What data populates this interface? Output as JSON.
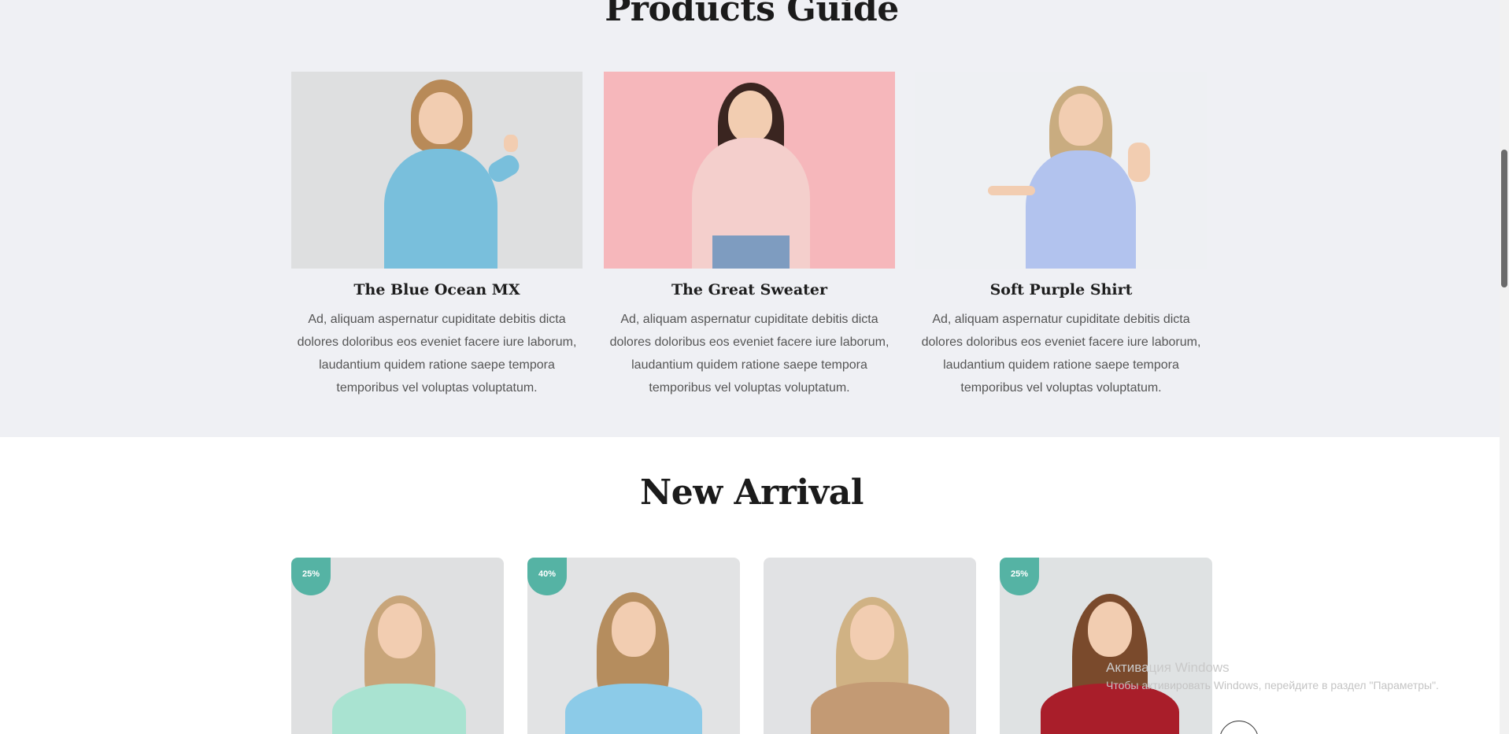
{
  "products_guide": {
    "title": "Products Guide",
    "items": [
      {
        "name": "The Blue Ocean MX",
        "description": "Ad, aliquam aspernatur cupiditate debitis dicta dolores doloribus eos eveniet facere iure laborum, laudantium quidem ratione saepe tempora temporibus vel voluptas voluptatum.",
        "bg": "#dedfe0",
        "garment": "#79bfdc"
      },
      {
        "name": "The Great Sweater",
        "description": "Ad, aliquam aspernatur cupiditate debitis dicta dolores doloribus eos eveniet facere iure laborum, laudantium quidem ratione saepe tempora temporibus vel voluptas voluptatum.",
        "bg": "#f6b7bb",
        "garment": "#f4cfcc"
      },
      {
        "name": "Soft Purple Shirt",
        "description": "Ad, aliquam aspernatur cupiditate debitis dicta dolores doloribus eos eveniet facere iure laborum, laudantium quidem ratione saepe tempora temporibus vel voluptas voluptatum.",
        "bg": "#eef0f3",
        "garment": "#b2c3ee"
      }
    ]
  },
  "new_arrival": {
    "title": "New Arrival",
    "items": [
      {
        "discount": "25%",
        "bg": "#dfe0e1",
        "garment": "#a9e3d1"
      },
      {
        "discount": "40%",
        "bg": "#e2e3e4",
        "garment": "#8ccbe8"
      },
      {
        "discount": "",
        "bg": "#e1e2e4",
        "garment": "#c39a74"
      },
      {
        "discount": "25%",
        "bg": "#dfe2e3",
        "garment": "#a91e2a"
      }
    ]
  },
  "os_overlay": {
    "activation_title": "Активация Windows",
    "activation_text": "Чтобы активировать Windows, перейдите в раздел \"Параметры\"."
  },
  "colors": {
    "accent": "#55b3a4",
    "section_bg": "#eff0f4"
  }
}
